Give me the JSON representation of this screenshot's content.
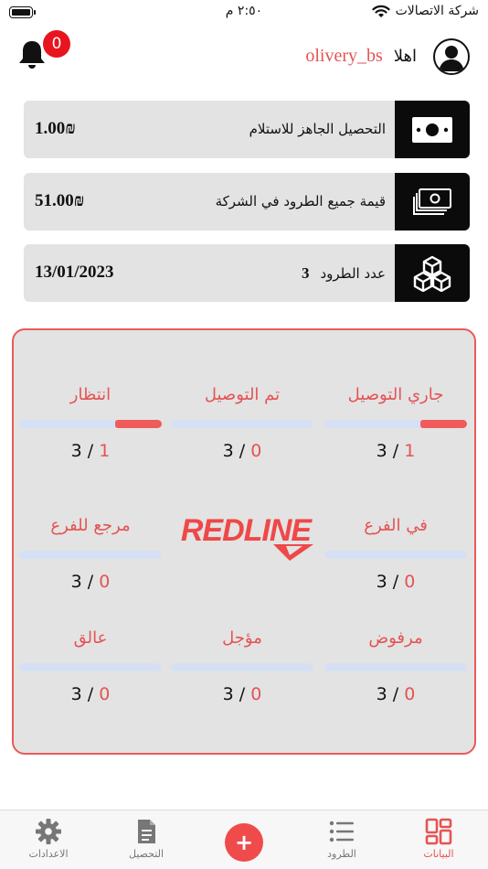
{
  "status_bar": {
    "carrier": "شركة الاتصالات",
    "time": "٢:٥٠ م"
  },
  "header": {
    "notifications_count": "0",
    "greeting": "اهلا",
    "username": "olivery_bs"
  },
  "cards": [
    {
      "label": "التحصيل الجاهز للاستلام",
      "value": "1.00₪",
      "icon": "cash-icon"
    },
    {
      "label": "قيمة جميع الطرود في الشركة",
      "value": "51.00₪",
      "icon": "cash-stack-icon"
    },
    {
      "label": "عدد الطرود",
      "count": "3",
      "value": "13/01/2023",
      "icon": "boxes-icon"
    }
  ],
  "status_grid": [
    {
      "label": "جاري التوصيل",
      "count": "1",
      "total": "3",
      "progress": 0.33
    },
    {
      "label": "تم التوصيل",
      "count": "0",
      "total": "3",
      "progress": 0
    },
    {
      "label": "انتظار",
      "count": "1",
      "total": "3",
      "progress": 0.33
    },
    {
      "label": "في الفرع",
      "count": "0",
      "total": "3",
      "progress": 0
    },
    {
      "label": "مرجع للفرع",
      "count": "0",
      "total": "3",
      "progress": 0
    },
    {
      "label": "مرفوض",
      "count": "0",
      "total": "3",
      "progress": 0
    },
    {
      "label": "مؤجل",
      "count": "0",
      "total": "3",
      "progress": 0
    },
    {
      "label": "عالق",
      "count": "0",
      "total": "3",
      "progress": 0
    }
  ],
  "logo_text": "REDLINE",
  "bottom_nav": {
    "dashboard": "البيانات",
    "parcels": "الطرود",
    "add": "+",
    "collection": "التحصيل",
    "settings": "الاعدادات"
  },
  "colors": {
    "accent": "#e55353",
    "badge": "#e8141e",
    "card_bg": "#e3e3e3",
    "icon_bg": "#0b0b0b",
    "bar_track": "#d6e0f5"
  }
}
